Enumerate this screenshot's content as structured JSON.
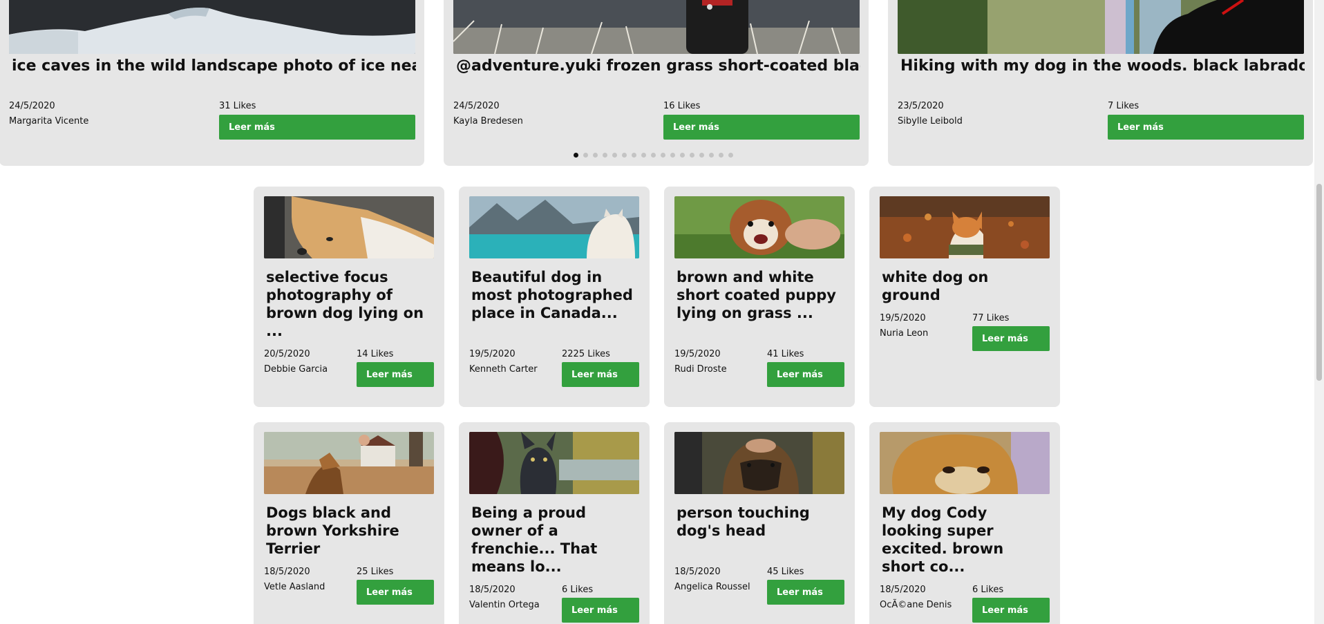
{
  "carousel": {
    "slides": [
      {
        "title": "ice caves in the wild landscape photo of ice near ...",
        "date": "24/5/2020",
        "author": "Margarita Vicente",
        "likes": "31 Likes",
        "button": "Leer más"
      },
      {
        "title": "@adventure.yuki frozen grass short-coated black do...",
        "date": "24/5/2020",
        "author": "Kayla Bredesen",
        "likes": "16 Likes",
        "button": "Leer más"
      },
      {
        "title": "Hiking with my dog in the woods. black labrador re...",
        "date": "23/5/2020",
        "author": "Sibylle Leibold",
        "likes": "7 Likes",
        "button": "Leer más"
      }
    ],
    "dot_count": 17,
    "active_dot": 0
  },
  "cards": [
    {
      "title": "selective focus photography of brown dog lying on ...",
      "date": "20/5/2020",
      "author": "Debbie Garcia",
      "likes": "14 Likes",
      "button": "Leer más"
    },
    {
      "title": "Beautiful dog in most photographed place in Canada...",
      "date": "19/5/2020",
      "author": "Kenneth Carter",
      "likes": "2225 Likes",
      "button": "Leer más"
    },
    {
      "title": "brown and white short coated puppy lying on grass ...",
      "date": "19/5/2020",
      "author": "Rudi Droste",
      "likes": "41 Likes",
      "button": "Leer más"
    },
    {
      "title": "white dog on ground",
      "date": "19/5/2020",
      "author": "Nuria Leon",
      "likes": "77 Likes",
      "button": "Leer más"
    },
    {
      "title": "Dogs black and brown Yorkshire Terrier",
      "date": "18/5/2020",
      "author": "Vetle Aasland",
      "likes": "25 Likes",
      "button": "Leer más"
    },
    {
      "title": "Being a proud owner of a frenchie... That means lo...",
      "date": "18/5/2020",
      "author": "Valentin Ortega",
      "likes": "6 Likes",
      "button": "Leer más"
    },
    {
      "title": "person touching dog's head",
      "date": "18/5/2020",
      "author": "Angelica Roussel",
      "likes": "45 Likes",
      "button": "Leer más"
    },
    {
      "title": "My dog Cody looking super excited. brown short co...",
      "date": "18/5/2020",
      "author": "OcÃ©ane Denis",
      "likes": "6 Likes",
      "button": "Leer más"
    }
  ],
  "colors": {
    "card_bg": "#e6e6e6",
    "button": "#33a03e"
  }
}
